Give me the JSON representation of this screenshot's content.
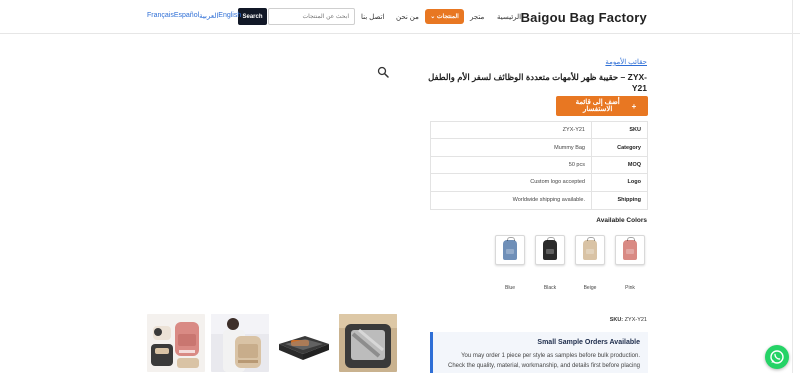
{
  "header": {
    "brand": "Baigou Bag Factory",
    "nav": {
      "home": "الرئيسية",
      "shop": "متجر",
      "products": "المنتجات ⌄",
      "about": "من نحن",
      "contact": "اتصل بنا"
    },
    "search": {
      "placeholder": "ابحث عن المنتجات",
      "button": "Search"
    },
    "languages": [
      "Français",
      "Español",
      "العربية",
      "English"
    ]
  },
  "product": {
    "breadcrumb": "حقائب الأمومة",
    "title": "حقيبة ظهر للأمهات متعددة الوظائف لسفر الأم والطفل – ZYX-Y21",
    "inquiry_button": "أضف إلى قائمة الاستفسار",
    "inquiry_icon": "+",
    "specs": [
      {
        "label": "SKU",
        "value": "ZYX-Y21"
      },
      {
        "label": "Category",
        "value": "Mummy Bag"
      },
      {
        "label": "MOQ",
        "value": "50 pcs"
      },
      {
        "label": "Logo",
        "value": "Custom logo accepted"
      },
      {
        "label": "Shipping",
        "value": "Worldwide shipping available."
      }
    ],
    "available_colors_label": "Available Colors",
    "colors": [
      {
        "name": "Pink",
        "hex": "#d98a84"
      },
      {
        "name": "Beige",
        "hex": "#d9c3a5"
      },
      {
        "name": "Black",
        "hex": "#2a2a2a"
      },
      {
        "name": "Blue",
        "hex": "#6f8fb8"
      }
    ],
    "sku_line_label": "SKU:",
    "sku_line_value": "ZYX-Y21",
    "sample": {
      "title": "Small Sample Orders Available",
      "line1": "You may order 1 piece per style as samples before bulk production.",
      "line2": "Check the quality, material, workmanship, and details first before placing"
    }
  },
  "gallery": {
    "zoom_icon": "search-icon",
    "thumbnail_count": 4
  },
  "whatsapp_icon": "whatsapp-icon",
  "colors": {
    "accent": "#e87722",
    "link": "#2f6fd6",
    "dark_button": "#111827",
    "whatsapp": "#25d366"
  }
}
